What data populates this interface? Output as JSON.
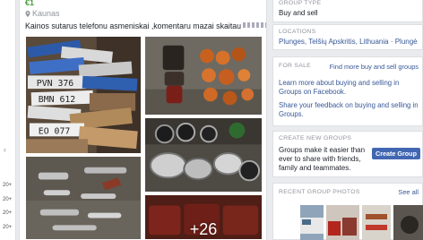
{
  "left": {
    "ticks": [
      "20+",
      "20+",
      "20+",
      "20+"
    ]
  },
  "post": {
    "price": "€1",
    "location": "Kaunas",
    "description": "Kainos sutarus telefonu asmeniskai ,komentaru mazai skaitau",
    "more_photos": "+26"
  },
  "sidebar": {
    "group_type_label": "GROUP TYPE",
    "group_type_value": "Buy and sell",
    "locations_label": "LOCATIONS",
    "locations_value": "Plunges, Telšių Apskritis, Lithuania · Plungė",
    "for_sale_label": "FOR SALE",
    "find_more_link": "Find more buy and sell groups",
    "learn_more": "Learn more about buying and selling in Groups on Facebook.",
    "share_feedback": "Share your feedback on buying and selling in Groups.",
    "create_label": "CREATE NEW GROUPS",
    "create_text": "Groups make it easier than ever to share with friends, family and teammates.",
    "create_button": "Create Group",
    "photos_label": "RECENT GROUP PHOTOS",
    "see_all": "See all"
  },
  "colors": {
    "accent": "#4267b2",
    "link": "#385898",
    "price": "#4b9b3d"
  }
}
